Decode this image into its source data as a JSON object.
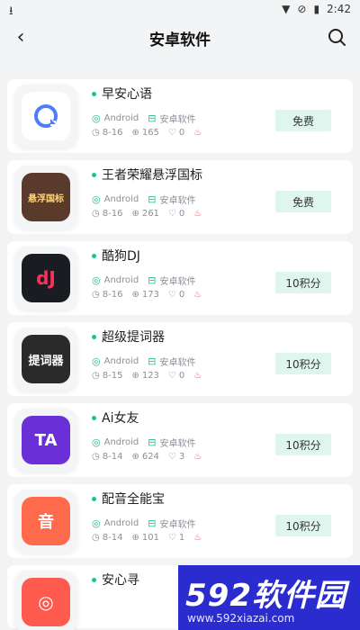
{
  "status": {
    "time": "2:42"
  },
  "nav": {
    "title": "安卓软件"
  },
  "apps": [
    {
      "name": "早安心语",
      "platform": "Android",
      "category": "安卓软件",
      "date": "8-16",
      "downloads": "165",
      "likes": "0",
      "price": "免费",
      "icon_label": "",
      "icon_bg": "#ffffff",
      "icon_fg": "#4e7cff",
      "icon_symbol": "◔"
    },
    {
      "name": "王者荣耀悬浮国标",
      "platform": "Android",
      "category": "安卓软件",
      "date": "8-16",
      "downloads": "261",
      "likes": "0",
      "price": "免费",
      "icon_label": "悬浮国标",
      "icon_bg": "#5a3a2b",
      "icon_fg": "#ffd36b",
      "icon_symbol": ""
    },
    {
      "name": "酷狗DJ",
      "platform": "Android",
      "category": "安卓软件",
      "date": "8-16",
      "downloads": "173",
      "likes": "0",
      "price": "10积分",
      "icon_label": "dJ",
      "icon_bg": "#1b1b22",
      "icon_fg": "#ff2f5b",
      "icon_symbol": ""
    },
    {
      "name": "超级提词器",
      "platform": "Android",
      "category": "安卓软件",
      "date": "8-15",
      "downloads": "123",
      "likes": "0",
      "price": "10积分",
      "icon_label": "提词器",
      "icon_bg": "#2a2a2a",
      "icon_fg": "#ffffff",
      "icon_symbol": ""
    },
    {
      "name": "Ai女友",
      "platform": "Android",
      "category": "安卓软件",
      "date": "8-14",
      "downloads": "624",
      "likes": "3",
      "price": "10积分",
      "icon_label": "TA",
      "icon_bg": "#6a2fd6",
      "icon_fg": "#ffffff",
      "icon_symbol": ""
    },
    {
      "name": "配音全能宝",
      "platform": "Android",
      "category": "安卓软件",
      "date": "8-14",
      "downloads": "101",
      "likes": "1",
      "price": "10积分",
      "icon_label": "音",
      "icon_bg": "#ff6a4d",
      "icon_fg": "#ffffff",
      "icon_symbol": ""
    },
    {
      "name": "安心寻",
      "platform": "",
      "category": "",
      "date": "",
      "downloads": "",
      "likes": "",
      "price": "",
      "icon_label": "",
      "icon_bg": "#ff5a4e",
      "icon_fg": "#ffffff",
      "icon_symbol": "◎"
    }
  ],
  "watermark": {
    "brand": "592软件园",
    "url": "www.592xiazai.com"
  },
  "colors": {
    "accent": "#1fbf8f",
    "price_bg": "#dff6ee",
    "fire": "#ff4d4f"
  }
}
